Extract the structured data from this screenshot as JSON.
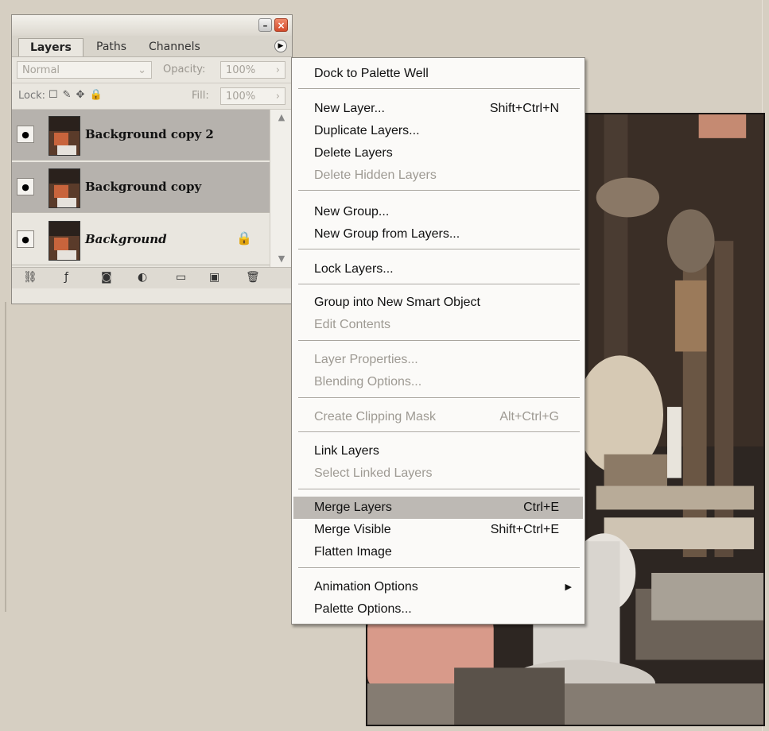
{
  "palette": {
    "tabs": [
      "Layers",
      "Paths",
      "Channels"
    ],
    "blend_mode": "Normal",
    "opacity_label": "Opacity:",
    "opacity_value": "100%",
    "lock_label": "Lock:",
    "fill_label": "Fill:",
    "fill_value": "100%",
    "layers": [
      {
        "name": "Background copy 2",
        "selected": true
      },
      {
        "name": "Background copy",
        "selected": true
      },
      {
        "name": "Background",
        "selected": false,
        "locked": true
      }
    ]
  },
  "menu": {
    "items": [
      {
        "label": "Dock to Palette Well",
        "shortcut": "",
        "disabled": false
      },
      {
        "label": "New Layer...",
        "shortcut": "Shift+Ctrl+N",
        "disabled": false
      },
      {
        "label": "Duplicate Layers...",
        "shortcut": "",
        "disabled": false
      },
      {
        "label": "Delete Layers",
        "shortcut": "",
        "disabled": false
      },
      {
        "label": "Delete Hidden Layers",
        "shortcut": "",
        "disabled": true
      },
      {
        "label": "New Group...",
        "shortcut": "",
        "disabled": false
      },
      {
        "label": "New Group from Layers...",
        "shortcut": "",
        "disabled": false
      },
      {
        "label": "Lock Layers...",
        "shortcut": "",
        "disabled": false
      },
      {
        "label": "Group into New Smart Object",
        "shortcut": "",
        "disabled": false
      },
      {
        "label": "Edit Contents",
        "shortcut": "",
        "disabled": true
      },
      {
        "label": "Layer Properties...",
        "shortcut": "",
        "disabled": true
      },
      {
        "label": "Blending Options...",
        "shortcut": "",
        "disabled": true
      },
      {
        "label": "Create Clipping Mask",
        "shortcut": "Alt+Ctrl+G",
        "disabled": true
      },
      {
        "label": "Link Layers",
        "shortcut": "",
        "disabled": false
      },
      {
        "label": "Select Linked Layers",
        "shortcut": "",
        "disabled": true
      },
      {
        "label": "Merge Layers",
        "shortcut": "Ctrl+E",
        "disabled": false,
        "highlighted": true
      },
      {
        "label": "Merge Visible",
        "shortcut": "Shift+Ctrl+E",
        "disabled": false
      },
      {
        "label": "Flatten Image",
        "shortcut": "",
        "disabled": false
      },
      {
        "label": "Animation Options",
        "shortcut": "",
        "disabled": false,
        "submenu": true
      },
      {
        "label": "Palette Options...",
        "shortcut": "",
        "disabled": false
      }
    ]
  },
  "colors": {
    "highlight": "#bdb9b4",
    "selected_layer": "#b6b2ad",
    "close_button": "#d44a2a"
  }
}
